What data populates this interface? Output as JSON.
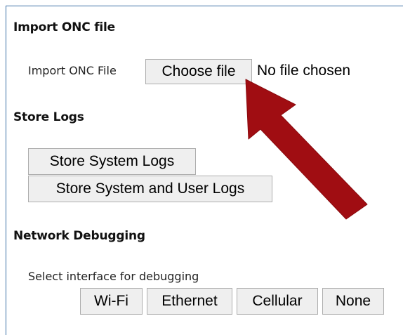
{
  "import_onc": {
    "heading": "Import ONC file",
    "field_label": "Import ONC File",
    "choose_button": "Choose file",
    "file_status": "No file chosen"
  },
  "store_logs": {
    "heading": "Store Logs",
    "system_logs_button": "Store System Logs",
    "system_user_logs_button": "Store System and User Logs"
  },
  "network_debugging": {
    "heading": "Network Debugging",
    "select_label": "Select interface for debugging",
    "interfaces": [
      "Wi-Fi",
      "Ethernet",
      "Cellular",
      "None"
    ]
  },
  "colors": {
    "arrow": "#a00d12",
    "frame_border": "#3a6ea5",
    "button_bg": "#efefef"
  },
  "annotation": {
    "icon": "red-arrow-icon"
  }
}
